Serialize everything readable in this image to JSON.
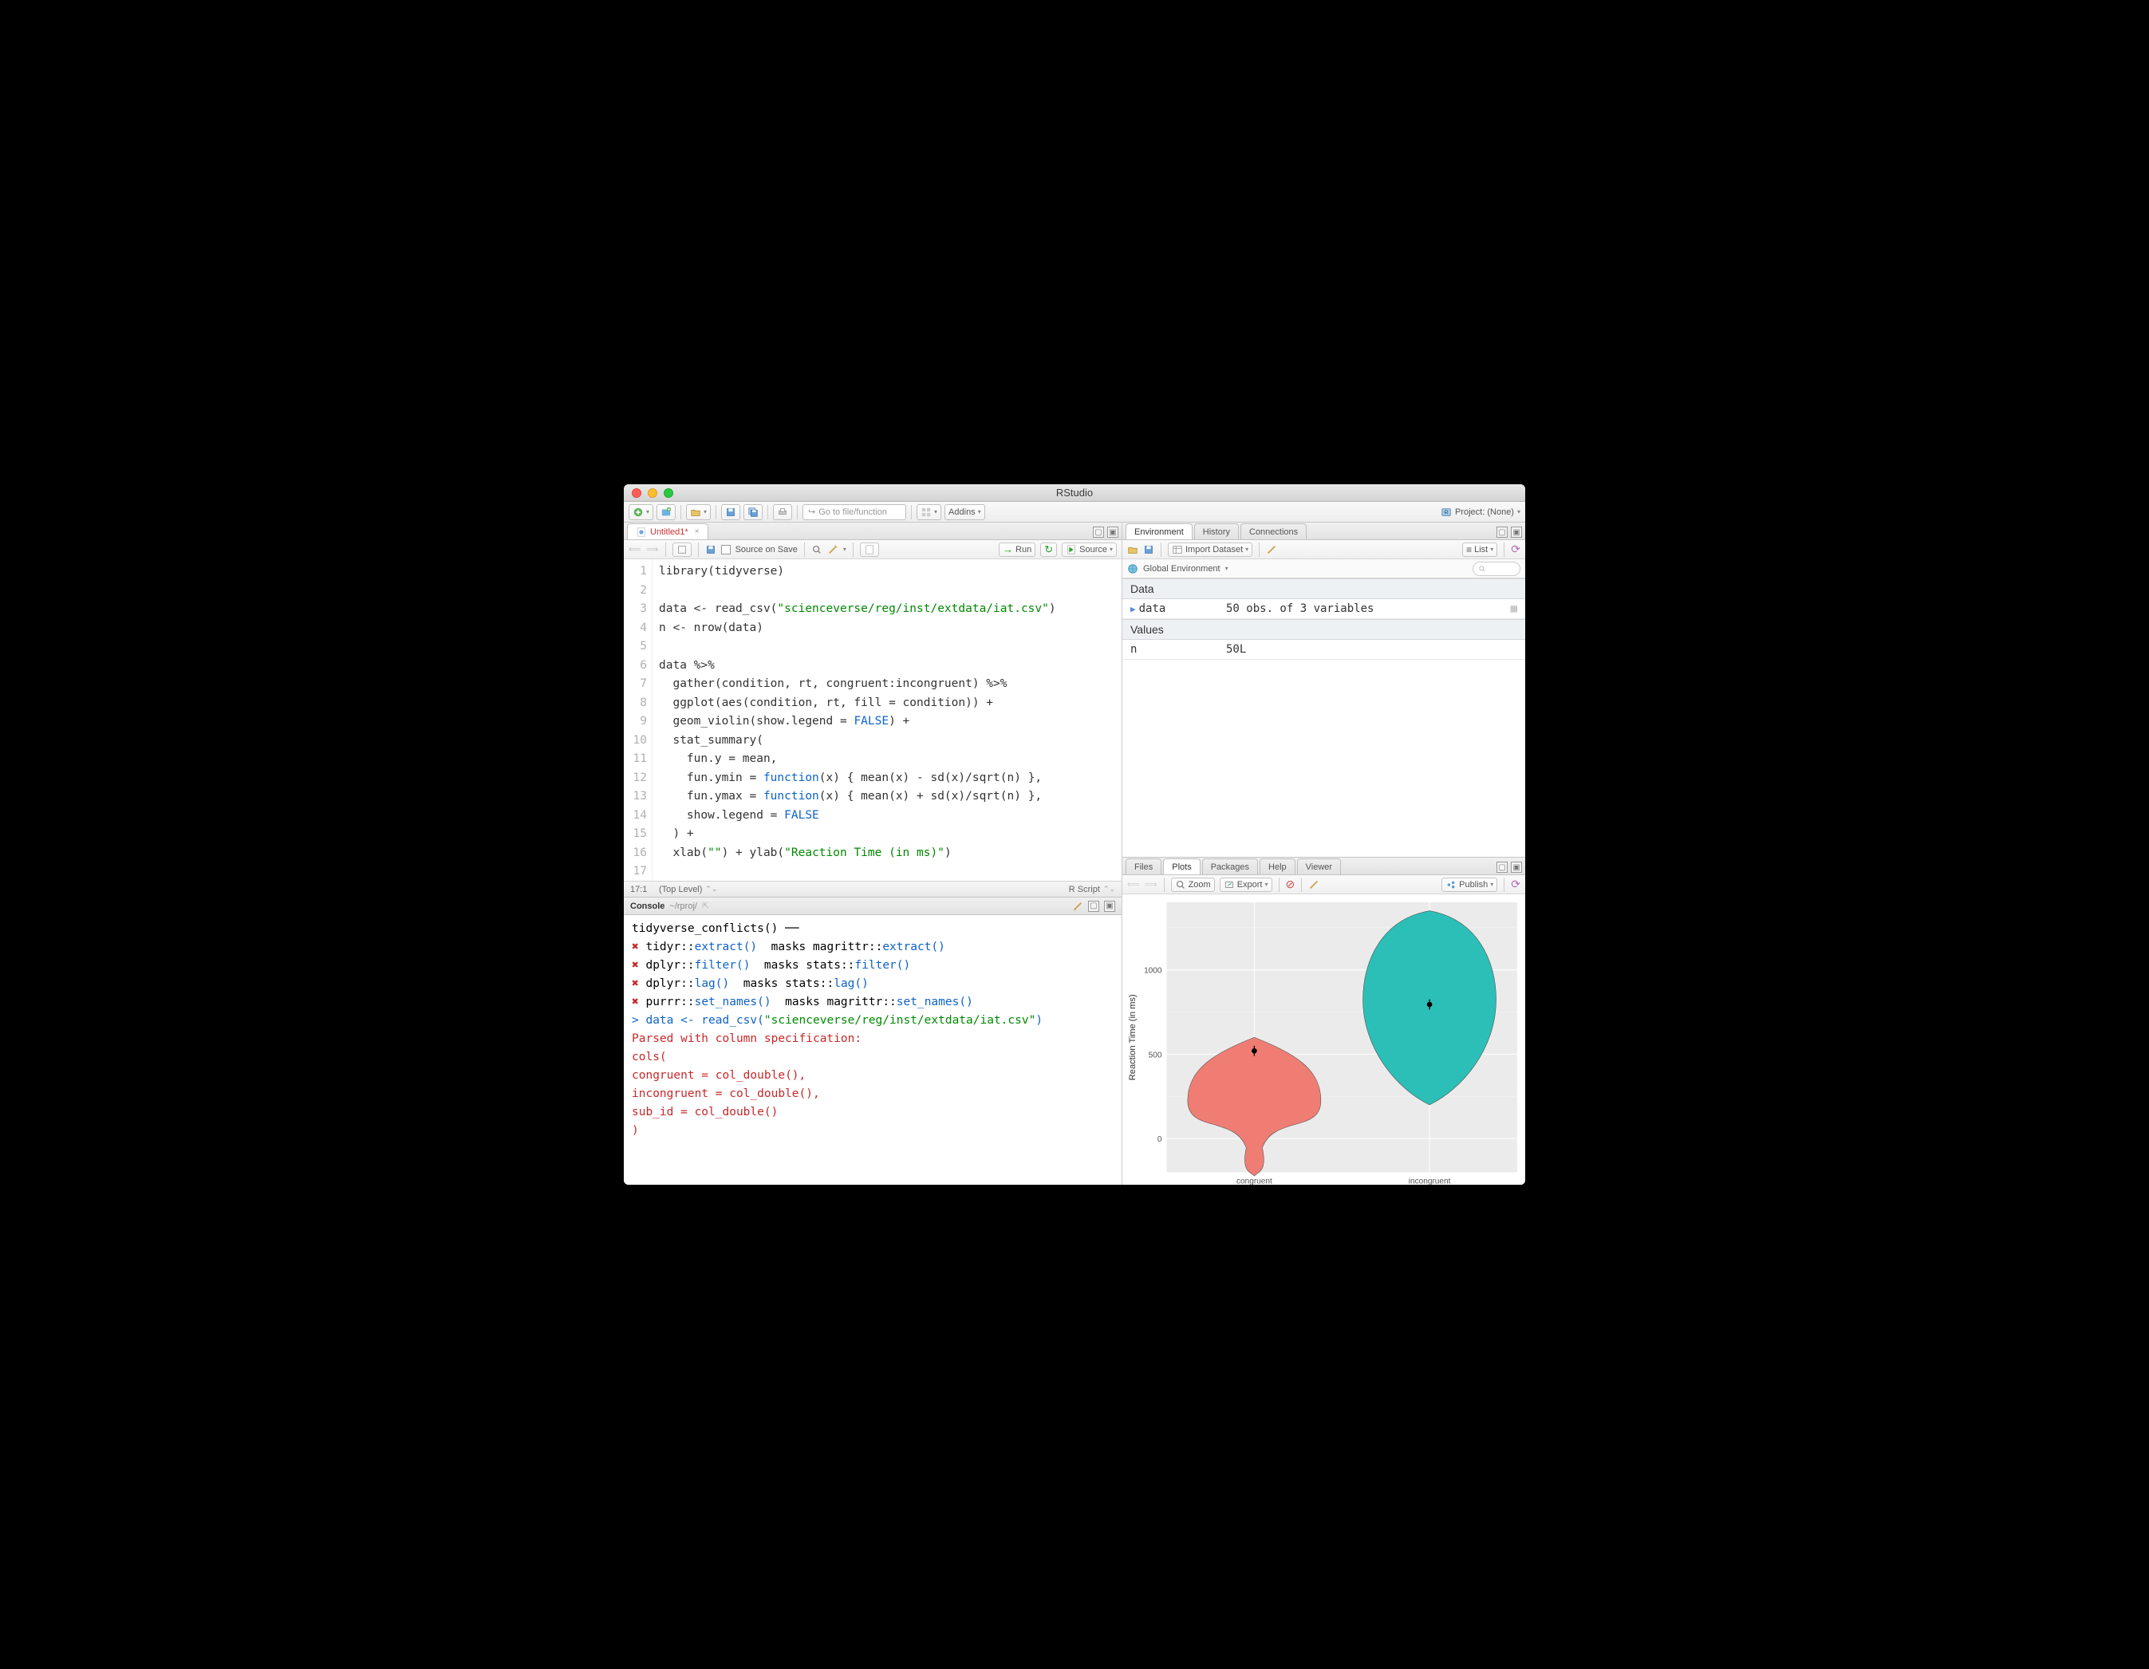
{
  "window": {
    "title": "RStudio"
  },
  "main_toolbar": {
    "goto_placeholder": "Go to file/function",
    "addins_label": "Addins",
    "project_label": "Project: (None)"
  },
  "source": {
    "tab_label": "Untitled1*",
    "source_on_save": "Source on Save",
    "run_label": "Run",
    "source_label": "Source",
    "status_pos": "17:1",
    "status_scope": "(Top Level)",
    "status_type": "R Script",
    "lines": [
      "library(tidyverse)",
      "",
      "data <- read_csv(\"scienceverse/reg/inst/extdata/iat.csv\")",
      "n <- nrow(data)",
      "",
      "data %>%",
      "  gather(condition, rt, congruent:incongruent) %>%",
      "  ggplot(aes(condition, rt, fill = condition)) +",
      "  geom_violin(show.legend = FALSE) +",
      "  stat_summary(",
      "    fun.y = mean,",
      "    fun.ymin = function(x) { mean(x) - sd(x)/sqrt(n) },",
      "    fun.ymax = function(x) { mean(x) + sd(x)/sqrt(n) },",
      "    show.legend = FALSE",
      "  ) +",
      "  xlab(\"\") + ylab(\"Reaction Time (in ms)\")",
      ""
    ]
  },
  "console": {
    "title": "Console",
    "path": "~/rproj/",
    "lines": [
      {
        "type": "plain",
        "text": "tidyverse_conflicts() ──"
      },
      {
        "type": "conflict",
        "pkg1": "tidyr",
        "fn1": "extract()",
        "masks": "masks",
        "pkg2": "magrittr",
        "fn2": "extract()"
      },
      {
        "type": "conflict",
        "pkg1": "dplyr",
        "fn1": "filter()",
        "masks": "masks",
        "pkg2": "stats",
        "fn2": "filter()"
      },
      {
        "type": "conflict",
        "pkg1": "dplyr",
        "fn1": "lag()",
        "masks": "masks",
        "pkg2": "stats",
        "fn2": "lag()"
      },
      {
        "type": "conflict",
        "pkg1": "purrr",
        "fn1": "set_names()",
        "masks": "masks",
        "pkg2": "magrittr",
        "fn2": "set_names()"
      },
      {
        "type": "input",
        "text": "data <- read_csv(\"scienceverse/reg/inst/extdata/iat.csv\")"
      },
      {
        "type": "msg",
        "text": "Parsed with column specification:"
      },
      {
        "type": "msg",
        "text": "cols("
      },
      {
        "type": "msg",
        "text": "  congruent = col_double(),"
      },
      {
        "type": "msg",
        "text": "  incongruent = col_double(),"
      },
      {
        "type": "msg",
        "text": "  sub_id = col_double()"
      },
      {
        "type": "msg",
        "text": ")"
      }
    ]
  },
  "env": {
    "tabs": [
      "Environment",
      "History",
      "Connections"
    ],
    "import_label": "Import Dataset",
    "list_label": "List",
    "scope_label": "Global Environment",
    "sections": {
      "Data": [
        {
          "name": "data",
          "value": "50 obs. of 3 variables",
          "expandable": true,
          "grid": true
        }
      ],
      "Values": [
        {
          "name": "n",
          "value": "50L"
        }
      ]
    }
  },
  "plots": {
    "tabs": [
      "Files",
      "Plots",
      "Packages",
      "Help",
      "Viewer"
    ],
    "active_tab": "Plots",
    "zoom_label": "Zoom",
    "export_label": "Export",
    "publish_label": "Publish"
  },
  "chart_data": {
    "type": "violin",
    "xlabel": "",
    "ylabel": "Reaction Time (in ms)",
    "categories": [
      "congruent",
      "incongruent"
    ],
    "y_ticks": [
      0,
      500,
      1000
    ],
    "ylim": [
      -200,
      1400
    ],
    "series": [
      {
        "name": "congruent",
        "fill": "#f07d74",
        "summary_mean": 520,
        "summary_se": 30,
        "approx_density_range": [
          -150,
          600
        ]
      },
      {
        "name": "incongruent",
        "fill": "#2cbfb7",
        "summary_mean": 795,
        "summary_se": 30,
        "approx_density_range": [
          200,
          1350
        ]
      }
    ]
  }
}
